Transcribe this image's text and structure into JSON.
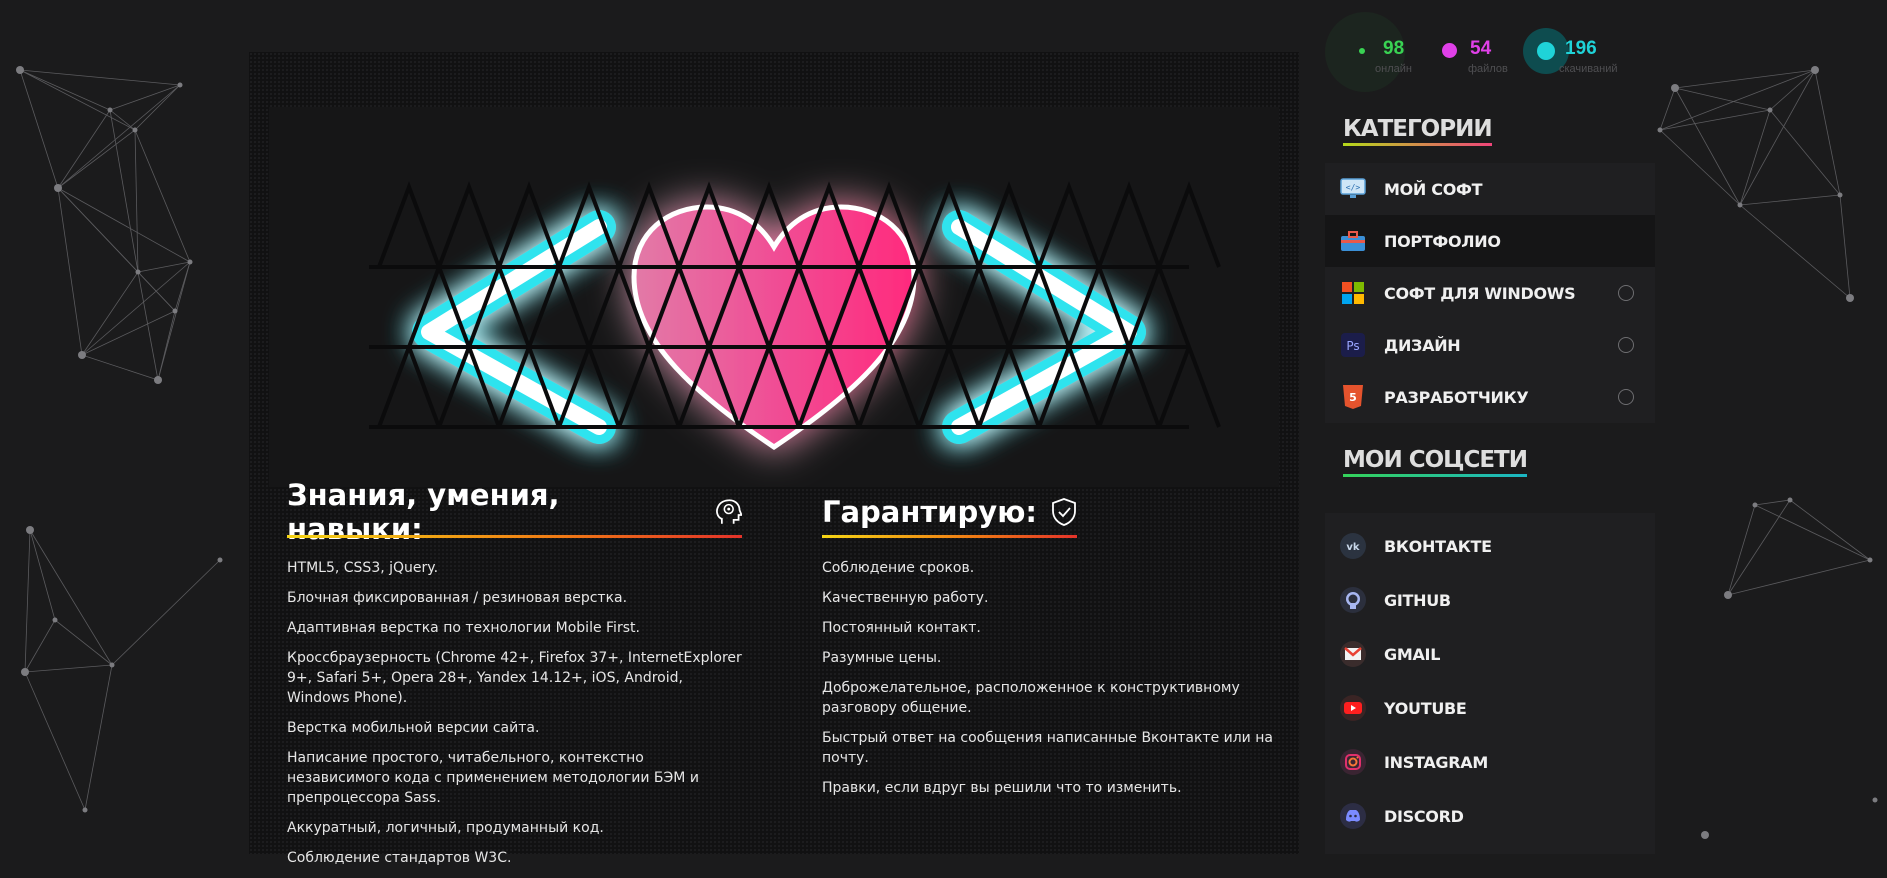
{
  "stats": [
    {
      "value": "98",
      "label": "онлайн",
      "color": "#39d353"
    },
    {
      "value": "54",
      "label": "файлов",
      "color": "#e040e8"
    },
    {
      "value": "196",
      "label": "скачиваний",
      "color": "#1fd3d8"
    }
  ],
  "knowledge": {
    "title": "Знания, умения, навыки:",
    "items": [
      "HTML5, CSS3, jQuery.",
      "Блочная фиксированная / резиновая верстка.",
      "Адаптивная верстка по технологии Mobile First.",
      "Кроссбраузерность (Chrome 42+, Firefox 37+, InternetExplorer 9+, Safari 5+, Opera 28+, Yandex 14.12+, iOS, Android, Windows Phone).",
      "Верстка мобильной версии сайта.",
      "Написание простого, читабельного, контекстно независимого кода с применением методологии БЭМ и препроцессора Sass.",
      "Аккуратный, логичный, продуманный код.",
      "Соблюдение стандартов W3C."
    ]
  },
  "guarantee": {
    "title": "Гарантирую:",
    "items": [
      "Соблюдение сроков.",
      "Качественную работу.",
      "Постоянный контакт.",
      "Разумные цены.",
      "Доброжелательное, расположенное к конструктивному разговору общение.",
      "Быстрый ответ на сообщения написанные Вконтакте или на почту.",
      "Правки, если вдруг вы решили что то изменить."
    ]
  },
  "sidebar": {
    "categories_title": "КАТЕГОРИИ",
    "categories": [
      {
        "label": "МОЙ СОФТ",
        "icon": "monitor-code-icon",
        "radio": false,
        "active": false
      },
      {
        "label": "ПОРТФОЛИО",
        "icon": "briefcase-icon",
        "radio": false,
        "active": true
      },
      {
        "label": "СОФТ ДЛЯ WINDOWS",
        "icon": "windows-icon",
        "radio": true,
        "active": false
      },
      {
        "label": "ДИЗАЙН",
        "icon": "photoshop-icon",
        "radio": true,
        "active": false
      },
      {
        "label": "РАЗРАБОТЧИКУ",
        "icon": "html5-icon",
        "radio": true,
        "active": false
      }
    ],
    "social_title": "МОИ СОЦСЕТИ",
    "social": [
      {
        "label": "ВКОНТАКТЕ",
        "icon": "vk-icon"
      },
      {
        "label": "GITHUB",
        "icon": "github-icon"
      },
      {
        "label": "GMAIL",
        "icon": "gmail-icon"
      },
      {
        "label": "YOUTUBE",
        "icon": "youtube-icon"
      },
      {
        "label": "INSTAGRAM",
        "icon": "instagram-icon"
      },
      {
        "label": "DISCORD",
        "icon": "discord-icon"
      }
    ]
  },
  "colors": {
    "accent_cyan": "#1fd3d8",
    "accent_pink": "#ff2f8c",
    "title_underline": "#f07a14",
    "categories_underline_start": "#b5d91a",
    "categories_underline_end": "#f0457a",
    "social_underline_start": "#35d35a",
    "social_underline_end": "#1bb6c4"
  }
}
